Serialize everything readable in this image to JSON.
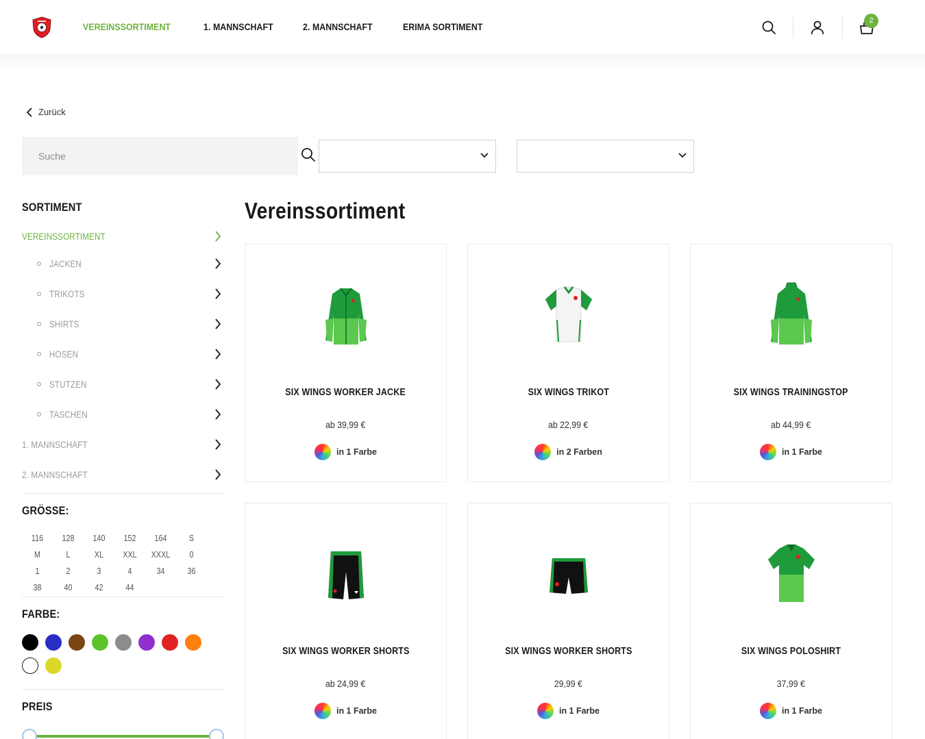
{
  "header": {
    "nav": [
      "VEREINSSORTIMENT",
      "1. MANNSCHAFT",
      "2. MANNSCHAFT",
      "ERIMA SORTIMENT"
    ],
    "cart_count": "2",
    "icons": [
      "search-icon",
      "account-icon",
      "cart-icon"
    ]
  },
  "back_label": "Zurück",
  "search": {
    "placeholder": "Suche"
  },
  "sidebar": {
    "sortiment_title": "SORTIMENT",
    "categories": [
      {
        "label": "VEREINSSORTIMENT"
      },
      {
        "label": "JACKEN"
      },
      {
        "label": "TRIKOTS"
      },
      {
        "label": "SHIRTS"
      },
      {
        "label": "HOSEN"
      },
      {
        "label": "STUTZEN"
      },
      {
        "label": "TASCHEN"
      },
      {
        "label": "1. MANNSCHAFT"
      },
      {
        "label": "2. MANNSCHAFT"
      }
    ],
    "size_title": "GRÖSSE:",
    "sizes": [
      "116",
      "128",
      "140",
      "152",
      "164",
      "S",
      "M",
      "L",
      "XL",
      "XXL",
      "XXXL",
      "0",
      "1",
      "2",
      "3",
      "4",
      "34",
      "36",
      "38",
      "40",
      "42",
      "44"
    ],
    "color_title": "FARBE:",
    "colors": [
      "#000000",
      "#2a2fc4",
      "#7a4414",
      "#5ec22d",
      "#8c8c8c",
      "#8f2fcf",
      "#e02424",
      "#ff7f0e",
      "#ffffff",
      "#dcd62a"
    ],
    "price_title": "PREIS"
  },
  "main": {
    "title": "Vereinssortiment",
    "products": [
      {
        "name": "SIX WINGS WORKER JACKE",
        "price": "ab 39,99 €",
        "colors": "in 1 Farbe"
      },
      {
        "name": "SIX WINGS TRIKOT",
        "price": "ab 22,99 €",
        "colors": "in 2 Farben"
      },
      {
        "name": "SIX WINGS TRAININGSTOP",
        "price": "ab 44,99 €",
        "colors": "in 1 Farbe"
      },
      {
        "name": "SIX WINGS WORKER SHORTS",
        "price": "ab 24,99 €",
        "colors": "in 1 Farbe"
      },
      {
        "name": "SIX WINGS WORKER SHORTS",
        "price": "29,99 €",
        "colors": "in 1 Farbe"
      },
      {
        "name": "SIX WINGS POLOSHIRT",
        "price": "37,99 €",
        "colors": "in 1 Farbe"
      }
    ]
  },
  "theme": {
    "accent": "#6cb33f"
  }
}
